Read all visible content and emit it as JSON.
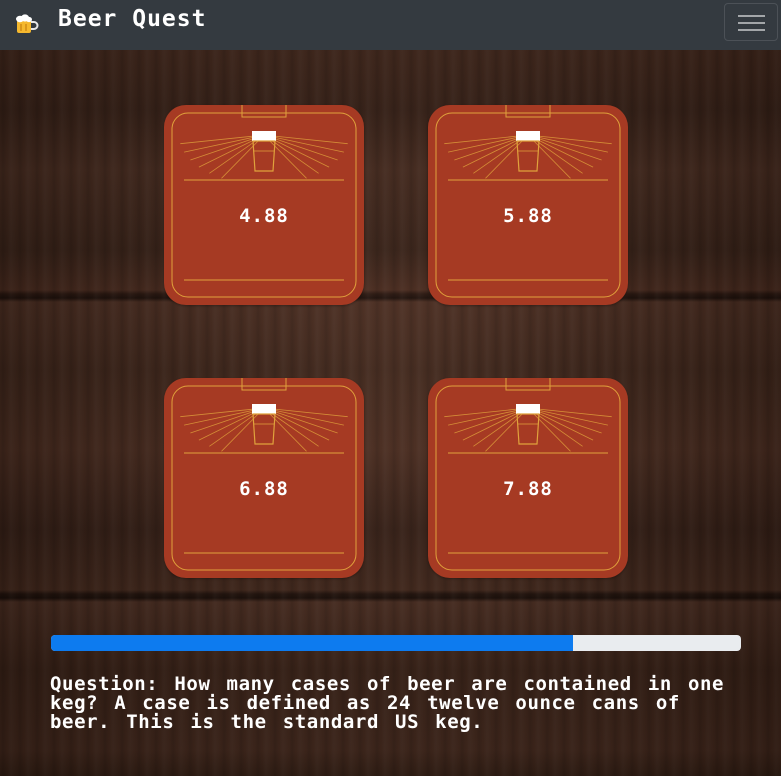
{
  "app": {
    "title": "Beer Quest",
    "icon": "beer-mug-icon"
  },
  "navbar": {
    "menu_icon": "hamburger-menu-icon"
  },
  "cards": [
    {
      "answer": "4.88"
    },
    {
      "answer": "5.88"
    },
    {
      "answer": "6.88"
    },
    {
      "answer": "7.88"
    }
  ],
  "progress": {
    "percent": 75.7
  },
  "question": {
    "text": "Question: How many cases of beer are contained in one keg? A case is defined as 24 twelve ounce cans of beer. This is the standard US keg."
  },
  "colors": {
    "navbar": "#343a40",
    "card": "#a63a23",
    "card_line": "#e0a23c",
    "progress": "#0d7bef",
    "progress_track": "#e9ecef"
  }
}
